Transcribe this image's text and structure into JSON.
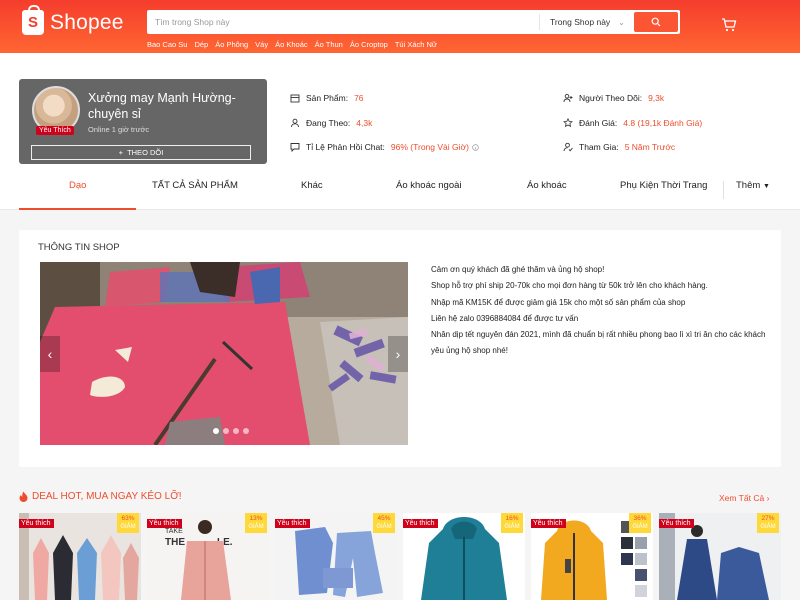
{
  "header": {
    "logo_text": "Shopee",
    "logo_glyph": "S",
    "search_placeholder": "Tìm trong Shop này",
    "search_scope": "Trong Shop này",
    "keywords": [
      "Bao Cao Su",
      "Dép",
      "Áo Phông",
      "Váy",
      "Áo Khoác",
      "Áo Thun",
      "Áo Croptop",
      "Túi Xách Nữ"
    ]
  },
  "shop": {
    "name": "Xưởng may Mạnh Hường-chuyên sỉ",
    "online": "Online 1 giờ trước",
    "badge": "Yêu Thích",
    "follow_label": "THEO DÕI",
    "stats": {
      "products_label": "Sản Phẩm:",
      "products_value": "76",
      "following_label": "Đang Theo:",
      "following_value": "4,3k",
      "chat_label": "Tỉ Lệ Phản Hồi Chat:",
      "chat_value": "96% (Trong Vài Giờ)",
      "followers_label": "Người Theo Dõi:",
      "followers_value": "9,3k",
      "rating_label": "Đánh Giá:",
      "rating_value": "4.8 (19,1k Đánh Giá)",
      "joined_label": "Tham Gia:",
      "joined_value": "5 Năm Trước"
    }
  },
  "tabs": [
    "Dạo",
    "TẤT CẢ SẢN PHẨM",
    "Khác",
    "Áo khoác ngoài",
    "Áo khoác",
    "Phụ Kiện Thời Trang",
    "Thêm"
  ],
  "active_tab": "Dạo",
  "shop_info": {
    "title": "THÔNG TIN SHOP",
    "lines": [
      "Cảm ơn quý khách đã ghé thăm và ủng hộ shop!",
      "Shop hỗ trợ phí ship 20-70k cho mọi đơn hàng từ 50k trở lên cho khách hàng.",
      "Nhập mã KM15K để được giảm giá 15k cho một số sản phẩm của shop",
      "Liên hệ zalo 0396884084 để được tư vấn",
      "Nhân dịp tết nguyên đán 2021, mình đã chuẩn bị rất nhiều phong bao lì xì tri ân cho các khách yêu ủng hộ shop nhé!"
    ],
    "slide_count": 4,
    "active_slide": 0
  },
  "deals": {
    "title": "DEAL HOT, MUA NGAY KẺO LỠ!",
    "see_all": "Xem Tất Cả",
    "products": [
      {
        "badge": "Yêu thích",
        "discount": "63%",
        "discount_label": "GIẢM"
      },
      {
        "badge": "Yêu thích",
        "discount": "13%",
        "discount_label": "GIẢM"
      },
      {
        "badge": "Yêu thích",
        "discount": "45%",
        "discount_label": "GIẢM"
      },
      {
        "badge": "Yêu thích",
        "discount": "16%",
        "discount_label": "GIẢM"
      },
      {
        "badge": "Yêu thích",
        "discount": "36%",
        "discount_label": "GIẢM"
      },
      {
        "badge": "Yêu thích",
        "discount": "27%",
        "discount_label": "GIẢM"
      }
    ]
  },
  "colors": {
    "brand": "#ee4d2d",
    "header_gradient_start": "#f53d2d",
    "header_gradient_end": "#ff6633",
    "badge_red": "#d0011b",
    "discount_yellow": "#ffd839"
  }
}
